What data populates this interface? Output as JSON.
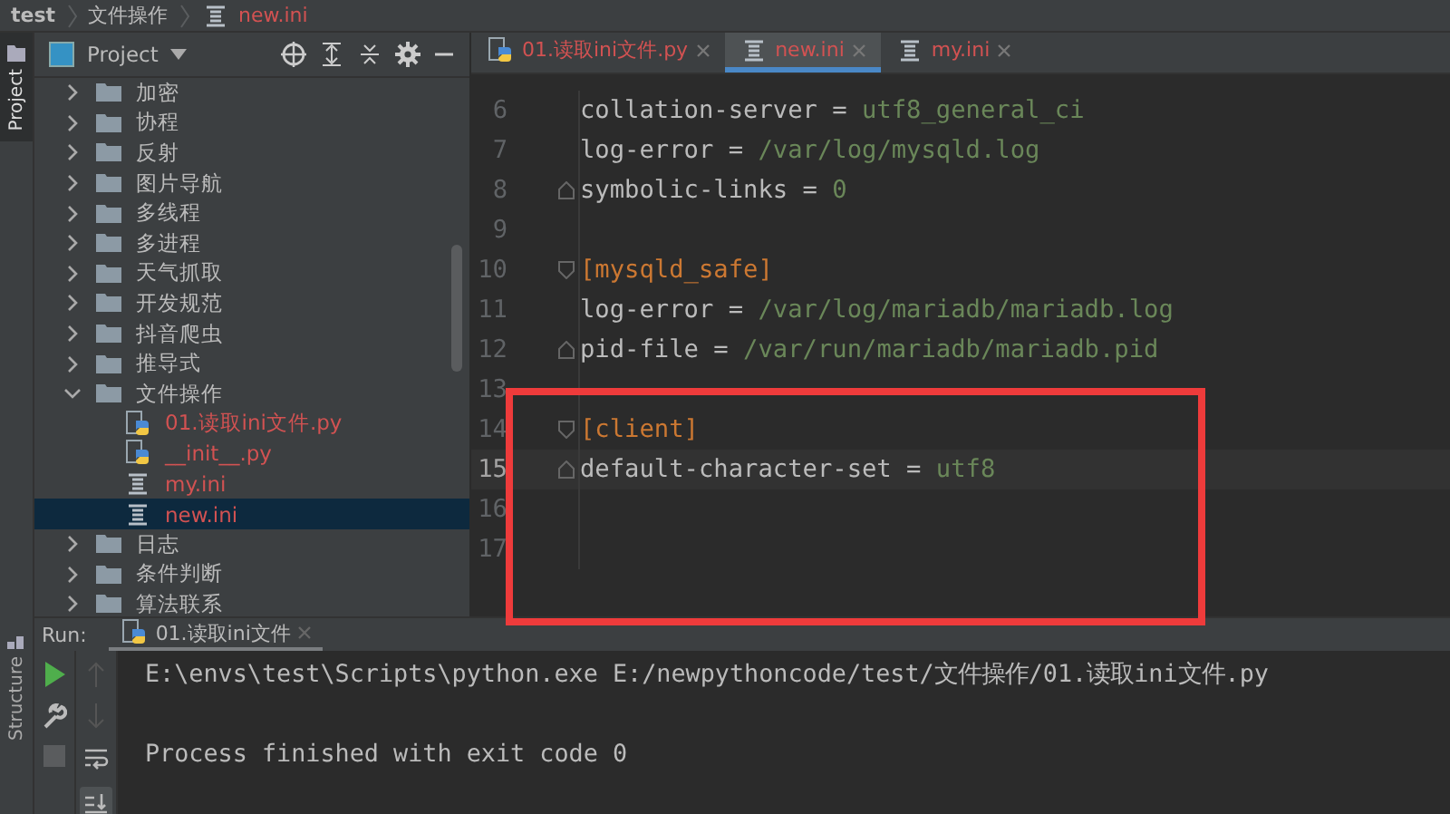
{
  "breadcrumbs": [
    {
      "label": "test",
      "kind": "project"
    },
    {
      "label": "文件操作",
      "kind": "folder"
    },
    {
      "label": "new.ini",
      "kind": "ini"
    }
  ],
  "side_tabs": [
    {
      "label": "Project",
      "selected": true,
      "kind": "project"
    },
    {
      "label": "Structure",
      "selected": false,
      "kind": "structure"
    }
  ],
  "project_panel": {
    "title": "Project",
    "tree": [
      {
        "label": "加密",
        "kind": "folder",
        "expanded": false,
        "selected": false,
        "unversioned": false
      },
      {
        "label": "协程",
        "kind": "folder",
        "expanded": false,
        "selected": false,
        "unversioned": false
      },
      {
        "label": "反射",
        "kind": "folder",
        "expanded": false,
        "selected": false,
        "unversioned": false
      },
      {
        "label": "图片导航",
        "kind": "folder",
        "expanded": false,
        "selected": false,
        "unversioned": false
      },
      {
        "label": "多线程",
        "kind": "folder",
        "expanded": false,
        "selected": false,
        "unversioned": false
      },
      {
        "label": "多进程",
        "kind": "folder",
        "expanded": false,
        "selected": false,
        "unversioned": false
      },
      {
        "label": "天气抓取",
        "kind": "folder",
        "expanded": false,
        "selected": false,
        "unversioned": false
      },
      {
        "label": "开发规范",
        "kind": "folder",
        "expanded": false,
        "selected": false,
        "unversioned": false
      },
      {
        "label": "抖音爬虫",
        "kind": "folder",
        "expanded": false,
        "selected": false,
        "unversioned": false
      },
      {
        "label": "推导式",
        "kind": "folder",
        "expanded": false,
        "selected": false,
        "unversioned": false
      },
      {
        "label": "文件操作",
        "kind": "folder",
        "expanded": true,
        "selected": false,
        "unversioned": false,
        "children": [
          {
            "label": "01.读取ini文件.py",
            "kind": "python",
            "selected": false,
            "unversioned": true
          },
          {
            "label": "__init__.py",
            "kind": "python",
            "selected": false,
            "unversioned": true
          },
          {
            "label": "my.ini",
            "kind": "ini",
            "selected": false,
            "unversioned": true
          },
          {
            "label": "new.ini",
            "kind": "ini",
            "selected": true,
            "unversioned": true
          }
        ]
      },
      {
        "label": "日志",
        "kind": "folder",
        "expanded": false,
        "selected": false,
        "unversioned": false
      },
      {
        "label": "条件判断",
        "kind": "folder",
        "expanded": false,
        "selected": false,
        "unversioned": false
      },
      {
        "label": "算法联系",
        "kind": "folder",
        "expanded": false,
        "selected": false,
        "unversioned": false
      }
    ]
  },
  "editor_tabs": [
    {
      "label": "01.读取ini文件.py",
      "kind": "python",
      "selected": false
    },
    {
      "label": "new.ini",
      "kind": "ini",
      "selected": true
    },
    {
      "label": "my.ini",
      "kind": "ini",
      "selected": false
    }
  ],
  "code_lines": [
    {
      "number": "6",
      "current": false,
      "fold_start": false,
      "fold_end": false,
      "segments": [
        {
          "kind": "key",
          "text": "collation-server = "
        },
        {
          "kind": "value",
          "text": "utf8_general_ci"
        }
      ]
    },
    {
      "number": "7",
      "current": false,
      "fold_start": false,
      "fold_end": false,
      "segments": [
        {
          "kind": "key",
          "text": "log-error = "
        },
        {
          "kind": "value",
          "text": "/var/log/mysqld.log"
        }
      ]
    },
    {
      "number": "8",
      "current": false,
      "fold_start": false,
      "fold_end": true,
      "segments": [
        {
          "kind": "key",
          "text": "symbolic-links = "
        },
        {
          "kind": "value",
          "text": "0"
        }
      ]
    },
    {
      "number": "9",
      "current": false,
      "fold_start": false,
      "fold_end": false
    },
    {
      "number": "10",
      "current": false,
      "fold_start": true,
      "fold_end": false,
      "segments": [
        {
          "kind": "section",
          "text": "[mysqld_safe]"
        }
      ]
    },
    {
      "number": "11",
      "current": false,
      "fold_start": false,
      "fold_end": false,
      "segments": [
        {
          "kind": "key",
          "text": "log-error = "
        },
        {
          "kind": "value",
          "text": "/var/log/mariadb/mariadb.log"
        }
      ]
    },
    {
      "number": "12",
      "current": false,
      "fold_start": false,
      "fold_end": true,
      "segments": [
        {
          "kind": "key",
          "text": "pid-file = "
        },
        {
          "kind": "value",
          "text": "/var/run/mariadb/mariadb.pid"
        }
      ]
    },
    {
      "number": "13",
      "current": false,
      "fold_start": false,
      "fold_end": false
    },
    {
      "number": "14",
      "current": false,
      "fold_start": true,
      "fold_end": false,
      "segments": [
        {
          "kind": "section",
          "text": "[client]"
        }
      ]
    },
    {
      "number": "15",
      "current": true,
      "fold_start": false,
      "fold_end": true,
      "segments": [
        {
          "kind": "key",
          "text": "default-character-set = "
        },
        {
          "kind": "value",
          "text": "utf8"
        }
      ]
    },
    {
      "number": "16",
      "current": false,
      "fold_start": false,
      "fold_end": false
    },
    {
      "number": "17",
      "current": false,
      "fold_start": false,
      "fold_end": false
    }
  ],
  "run_panel": {
    "label": "Run:",
    "tab": "01.读取ini文件",
    "output": [
      "E:\\envs\\test\\Scripts\\python.exe E:/newpythoncode/test/文件操作/01.读取ini文件.py",
      "Process finished with exit code 0"
    ]
  }
}
